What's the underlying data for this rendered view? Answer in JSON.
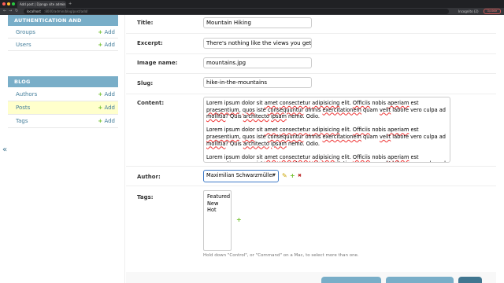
{
  "browser": {
    "tab_title": "Add post | Django site admin",
    "address_host": "localhost",
    "address_path": ":8000/admin/blog/post/add/",
    "incognito_label": "Incognito (2)",
    "update_label": "Update"
  },
  "sidebar": {
    "auth": {
      "caption": "Authentication and Authorization",
      "items": [
        {
          "name": "Groups",
          "add": "Add"
        },
        {
          "name": "Users",
          "add": "Add"
        }
      ]
    },
    "blog": {
      "caption": "Blog",
      "items": [
        {
          "name": "Authors",
          "add": "Add"
        },
        {
          "name": "Posts",
          "add": "Add"
        },
        {
          "name": "Tags",
          "add": "Add"
        }
      ]
    }
  },
  "form": {
    "title": {
      "label": "Title:",
      "value": "Mountain Hiking"
    },
    "excerpt": {
      "label": "Excerpt:",
      "value": "There's nothing like the views you get when hi"
    },
    "image_name": {
      "label": "Image name:",
      "value": "mountains.jpg"
    },
    "slug": {
      "label": "Slug:",
      "value": "hike-in-the-mountains"
    },
    "content": {
      "label": "Content:",
      "paragraph": "Lorem ipsum dolor sit amet consectetur adipisicing elit. Officiis nobis aperiam est praesentium, quos iste consequuntur omnis exercitationem quam velit labore vero culpa ad mollitia? Quis architecto ipsam nemo. Odio."
    },
    "author": {
      "label": "Author:",
      "selected": "Maximilian Schwarzmüller"
    },
    "tags": {
      "label": "Tags:",
      "options": [
        "Featured",
        "New",
        "Hot"
      ],
      "help": "Hold down \"Control\", or \"Command\" on a Mac, to select more than one."
    }
  },
  "colors": {
    "module_caption": "#79aec8",
    "current_row": "#ffffcc",
    "link": "#447e9b",
    "add_green": "#70bf2b",
    "save_button": "#417690"
  },
  "icons": {
    "collapse": "«",
    "plus": "+",
    "edit": "✎",
    "delete": "✖"
  }
}
